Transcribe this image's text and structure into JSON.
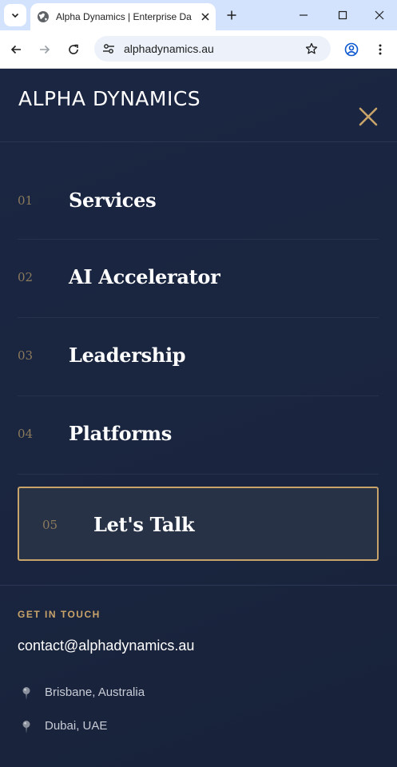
{
  "browser": {
    "tab_title": "Alpha Dynamics | Enterprise Da",
    "url": "alphadynamics.au"
  },
  "site": {
    "logo": "ALPHA DYNAMICS"
  },
  "nav": {
    "items": [
      {
        "num": "01",
        "label": "Services"
      },
      {
        "num": "02",
        "label": "AI Accelerator"
      },
      {
        "num": "03",
        "label": "Leadership"
      },
      {
        "num": "04",
        "label": "Platforms"
      }
    ],
    "cta": {
      "num": "05",
      "label": "Let's Talk"
    }
  },
  "contact": {
    "heading": "GET IN TOUCH",
    "email": "contact@alphadynamics.au",
    "locations": [
      "Brisbane, Australia",
      "Dubai, UAE"
    ]
  },
  "colors": {
    "background": "#1a2540",
    "accent_gold": "#c9a46a",
    "text_white": "#ffffff"
  }
}
